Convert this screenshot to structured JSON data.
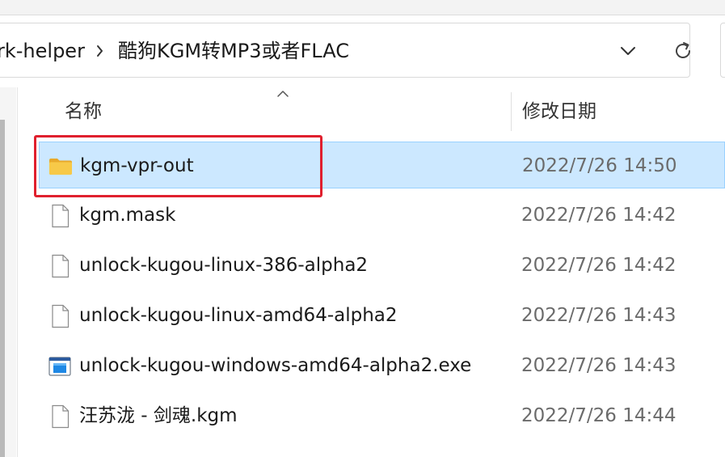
{
  "address_bar": {
    "crumbs": [
      "rk-helper",
      "酷狗KGM转MP3或者FLAC"
    ]
  },
  "columns": {
    "name": "名称",
    "date_modified": "修改日期"
  },
  "files": [
    {
      "name": "kgm-vpr-out",
      "date": "2022/7/26 14:50",
      "type": "folder",
      "icon": "folder-icon",
      "selected": true
    },
    {
      "name": "kgm.mask",
      "date": "2022/7/26 14:42",
      "type": "file",
      "icon": "file-icon",
      "selected": false
    },
    {
      "name": "unlock-kugou-linux-386-alpha2",
      "date": "2022/7/26 14:42",
      "type": "file",
      "icon": "file-icon",
      "selected": false
    },
    {
      "name": "unlock-kugou-linux-amd64-alpha2",
      "date": "2022/7/26 14:43",
      "type": "file",
      "icon": "file-icon",
      "selected": false
    },
    {
      "name": "unlock-kugou-windows-amd64-alpha2.exe",
      "date": "2022/7/26 14:43",
      "type": "exe",
      "icon": "exe-icon",
      "selected": false
    },
    {
      "name": "汪苏泷 - 剑魂.kgm",
      "date": "2022/7/26 14:44",
      "type": "file",
      "icon": "file-icon",
      "selected": false
    }
  ],
  "colors": {
    "selection_bg": "#cce8ff",
    "selection_border": "#99d1ff",
    "highlight_annotation": "#e0202e",
    "folder_yellow": "#f7c948"
  },
  "icons": {
    "breadcrumb_separator": "chevron-right-icon",
    "address_dropdown": "chevron-down-icon",
    "refresh": "refresh-icon",
    "sort_indicator": "sort-ascending-icon"
  }
}
